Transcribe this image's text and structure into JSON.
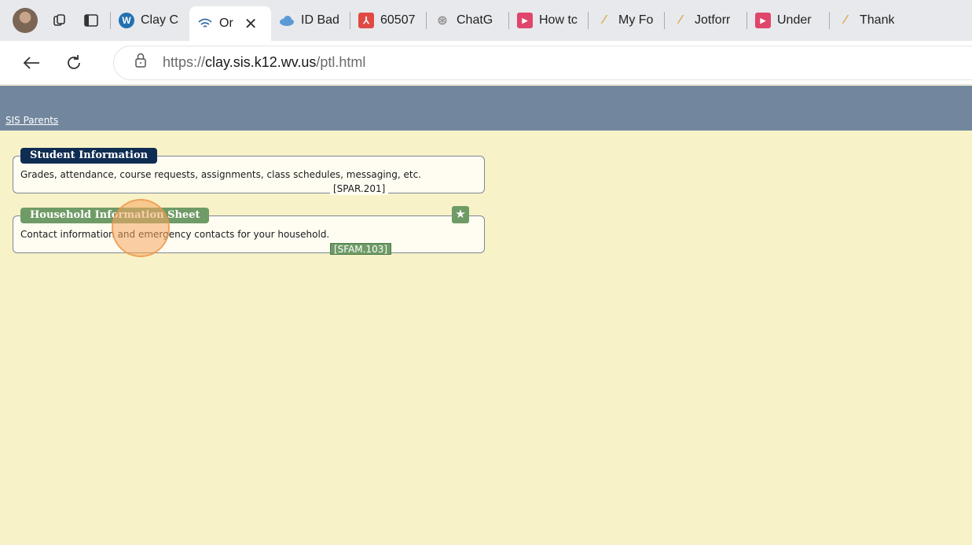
{
  "browser": {
    "tabs": [
      {
        "title": "Clay C",
        "favicon": "wordpress-icon",
        "color": "#2271b1",
        "active": false
      },
      {
        "title": "Or",
        "favicon": "wifi-icon",
        "color": "#3b6fa8",
        "active": true
      },
      {
        "title": "ID Bad",
        "favicon": "onedrive-cloud-icon",
        "color": "#5a9ad6",
        "active": false
      },
      {
        "title": "60507",
        "favicon": "pdf-icon",
        "color": "#e04a45",
        "active": false
      },
      {
        "title": "ChatG",
        "favicon": "chatgpt-icon",
        "color": "#9a9a9a",
        "active": false
      },
      {
        "title": "How tc",
        "favicon": "video-icon",
        "color": "#e0456b",
        "active": false
      },
      {
        "title": "My Fo",
        "favicon": "form-icon",
        "color": "#d9a94a",
        "active": false
      },
      {
        "title": "Jotforr",
        "favicon": "jotform-icon",
        "color": "#d9a94a",
        "active": false
      },
      {
        "title": "Under",
        "favicon": "video-icon",
        "color": "#e0456b",
        "active": false
      },
      {
        "title": "Thank",
        "favicon": "form-icon",
        "color": "#d9a94a",
        "active": false
      }
    ],
    "url_scheme": "https://",
    "url_host": "clay.sis.k12.wv.us",
    "url_path": "/ptl.html"
  },
  "page": {
    "nav_link": "SIS Parents",
    "cards": [
      {
        "title": "Student Information",
        "description": "Grades, attendance, course requests, assignments, class schedules, messaging, etc.",
        "code": "[SPAR.201]"
      },
      {
        "title": "Household Information Sheet",
        "description": "Contact information and emergency contacts for your household.",
        "code": "[SFAM.103]",
        "favorite_icon": "star-icon"
      }
    ]
  },
  "colors": {
    "banner": "#72879e",
    "page_bg": "#f8f2c8",
    "student_title_bg": "#0f2d52",
    "household_title_bg": "#6f9b66"
  }
}
